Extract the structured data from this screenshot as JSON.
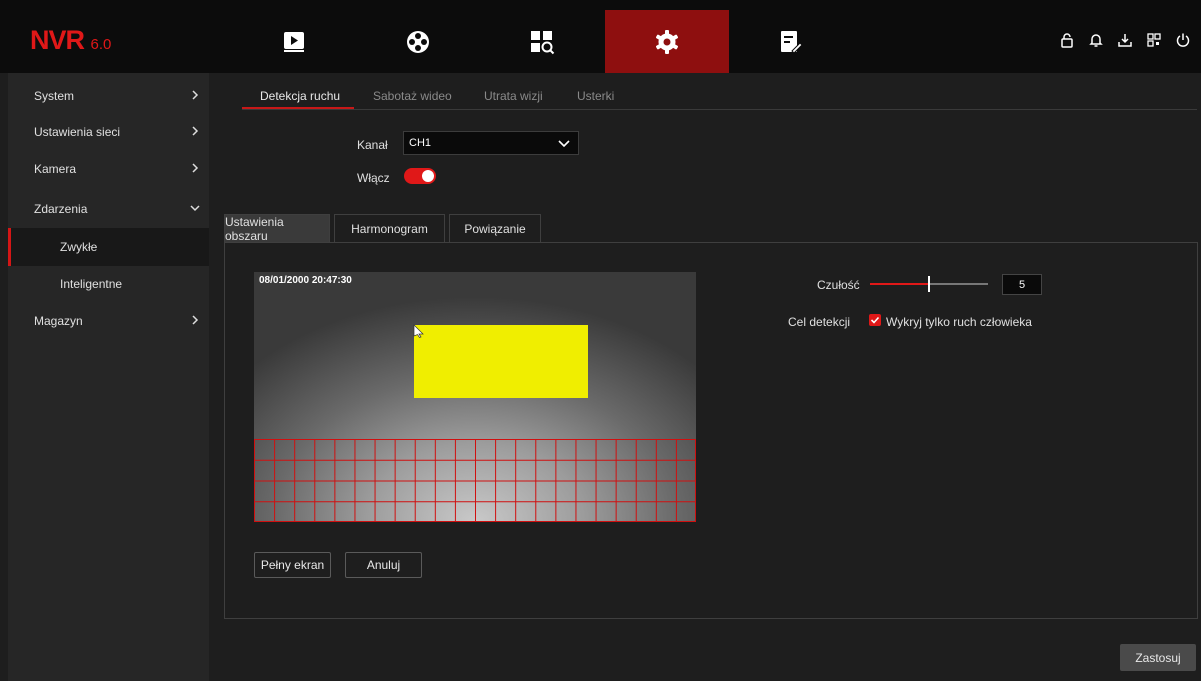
{
  "app": {
    "logo": "NVR",
    "version": "6.0"
  },
  "topnav": [
    {
      "name": "playback-icon"
    },
    {
      "name": "reel-icon"
    },
    {
      "name": "search-grid-icon"
    },
    {
      "name": "settings-gear-icon",
      "active": true
    },
    {
      "name": "maintenance-icon"
    }
  ],
  "top_icons": [
    "lock-icon",
    "bell-icon",
    "download-icon",
    "qr-icon",
    "power-icon"
  ],
  "sidebar": {
    "items": [
      {
        "label": "System",
        "chevron": "right"
      },
      {
        "label": "Ustawienia sieci",
        "chevron": "right"
      },
      {
        "label": "Kamera",
        "chevron": "right"
      },
      {
        "label": "Zdarzenia",
        "chevron": "down"
      },
      {
        "label": "Zwykłe",
        "sub": true,
        "active": true
      },
      {
        "label": "Inteligentne",
        "sub": true
      },
      {
        "label": "Magazyn",
        "chevron": "right"
      }
    ]
  },
  "tabs": [
    "Detekcja ruchu",
    "Sabotaż wideo",
    "Utrata wizji",
    "Usterki"
  ],
  "channel": {
    "label": "Kanał",
    "value": "CH1"
  },
  "enable": {
    "label": "Włącz",
    "on": true
  },
  "subtabs": [
    "Ustawienia obszaru",
    "Harmonogram",
    "Powiązanie"
  ],
  "video": {
    "timestamp": "08/01/2000  20:47:30"
  },
  "buttons": {
    "fullscreen": "Pełny ekran",
    "cancel": "Anuluj",
    "apply": "Zastosuj"
  },
  "sensitivity": {
    "label": "Czułość",
    "value": "5",
    "level_fraction": 0.5
  },
  "target": {
    "label": "Cel detekcji",
    "option": "Wykryj tylko ruch człowieka",
    "checked": true
  },
  "colors": {
    "accent": "#e01818",
    "active_nav": "#8e0f0f",
    "zone": "#f0ee00"
  }
}
